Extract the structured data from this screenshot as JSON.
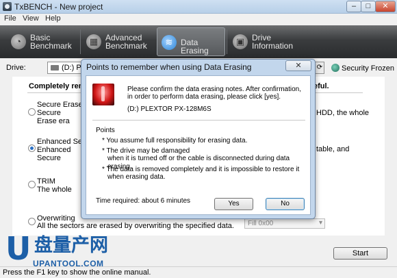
{
  "window": {
    "title": "TxBENCH - New project"
  },
  "menu": {
    "file": "File",
    "view": "View",
    "help": "Help"
  },
  "tabs": [
    {
      "line1": "Basic",
      "line2": "Benchmark"
    },
    {
      "line1": "Advanced",
      "line2": "Benchmark"
    },
    {
      "line1": "Data Erasing",
      "line2": ""
    },
    {
      "line1": "Drive",
      "line2": "Information"
    }
  ],
  "drive": {
    "label": "Drive:",
    "value": "(D:) P",
    "frozen": "Security Frozen"
  },
  "main": {
    "heading_left": "Completely remo",
    "heading_right": "eful.",
    "options": [
      {
        "title": "Secure Erase",
        "desc": "Secure Erase era area of the drive",
        "side": "HDD, the whole",
        "checked": false
      },
      {
        "title": "Enhanced Secure",
        "desc": "Enhanced Secure erases data on N",
        "side": "table, and",
        "checked": true
      },
      {
        "title": "TRIM",
        "desc": "The whole SSD a",
        "side": "",
        "checked": false
      },
      {
        "title": "Overwriting",
        "desc": "All the sectors are erased by overwriting the specified data.",
        "side": "",
        "checked": false
      }
    ],
    "fill_value": "Fill 0x00",
    "start": "Start"
  },
  "status": "Press the F1 key to show the online manual.",
  "watermark": {
    "u": "U",
    "cn": "盘量产网",
    "url": "UPANTOOL.COM"
  },
  "dialog": {
    "title": "Points to remember when using Data Erasing",
    "close": "✕",
    "message": "Please confirm the data erasing notes. After confirmation, in order to perform data erasing, please click [yes].",
    "drive": "(D:) PLEXTOR PX-128M6S",
    "points_heading": "Points",
    "points": [
      "* You assume full responsibility for erasing data.",
      "* The drive may be damaged",
      "  when it is turned off or the cable is disconnected during data erasing.",
      "* The data is removed completely and it is impossible to restore it",
      "  when erasing data."
    ],
    "time": "Time required: about 6 minutes",
    "yes": "Yes",
    "no": "No"
  }
}
